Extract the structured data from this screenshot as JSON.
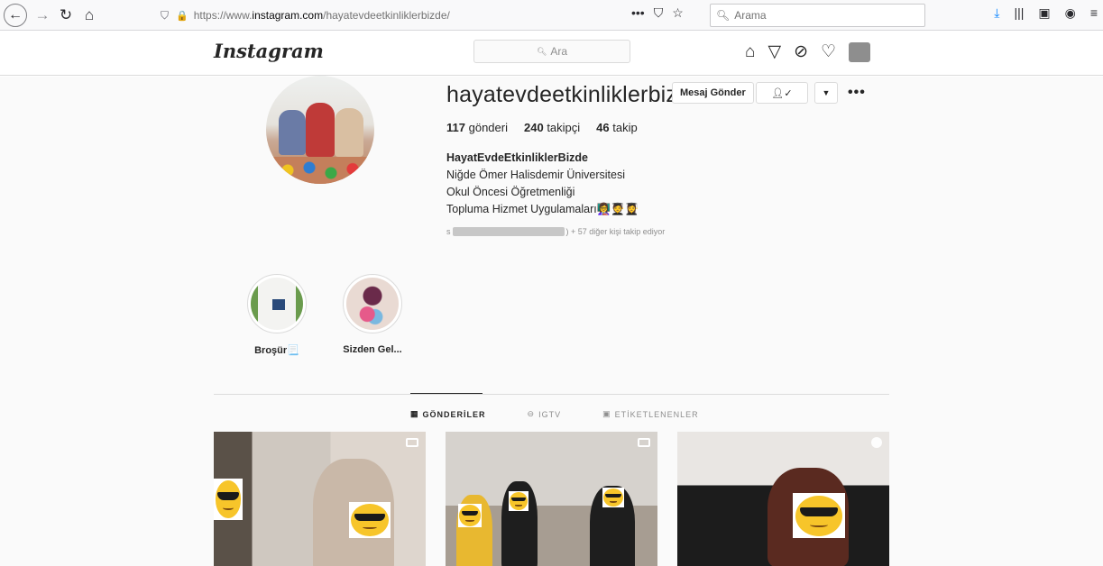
{
  "browser": {
    "back_icon": "back-arrow-icon",
    "forward_icon": "forward-arrow-icon",
    "reload_icon": "reload-icon",
    "home_icon": "home-icon",
    "url_prefix": "https://www.",
    "url_domain": "instagram.com",
    "url_path": "/hayatevdeetkinliklerbizde/",
    "page_actions": "•••",
    "search_placeholder": "Arama"
  },
  "ig_header": {
    "logo": "Instagram",
    "search_placeholder": "Ara"
  },
  "profile": {
    "username": "hayatevdeetkinliklerbizde",
    "message_button": "Mesaj Gönder",
    "more_label": "•••",
    "stats": {
      "posts_count": "117",
      "posts_label": "gönderi",
      "followers_count": "240",
      "followers_label": "takipçi",
      "following_count": "46",
      "following_label": "takip"
    },
    "bio": {
      "name": "HayatEvdeEtkinliklerBizde",
      "line1": "Niğde Ömer Halisdemir Üniversitesi",
      "line2": "Okul Öncesi Öğretmenliği",
      "line3": "Topluma Hizmet Uygulamaları👩‍🏫🧑‍🎓👩‍🎓"
    },
    "followed_by_prefix": "s",
    "followed_by_suffix": ") + 57 diğer kişi takip ediyor"
  },
  "highlights": [
    {
      "label": "Broşür📃"
    },
    {
      "label": "Sizden Gel..."
    }
  ],
  "tabs": [
    {
      "label": "GÖNDERİLER",
      "icon": "grid-icon",
      "active": true
    },
    {
      "label": "IGTV",
      "icon": "igtv-icon",
      "active": false
    },
    {
      "label": "ETİKETLENENLER",
      "icon": "tagged-icon",
      "active": false
    }
  ],
  "colors": {
    "accent": "#0095f6",
    "text": "#262626",
    "muted": "#8e8e8e",
    "border": "#dbdbdb",
    "background": "#fafafa"
  }
}
